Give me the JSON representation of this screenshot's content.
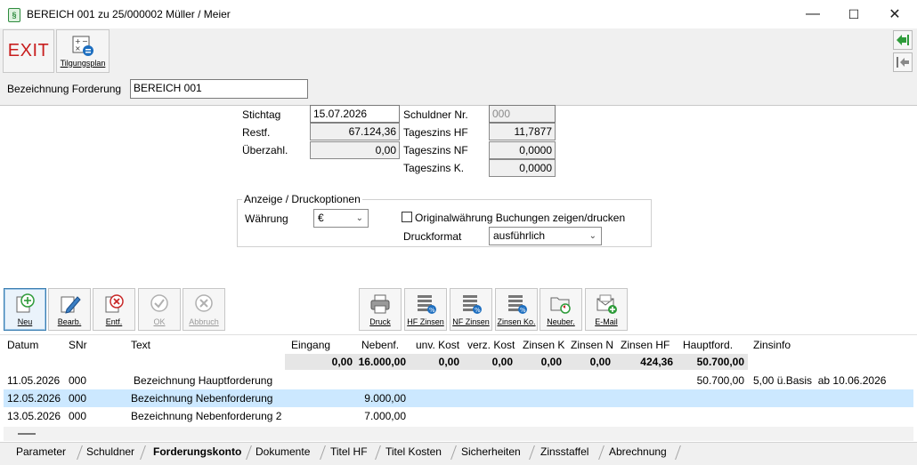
{
  "window": {
    "title": "BEREICH 001 zu 25/000002 Müller / Meier",
    "app_icon": "document-icon",
    "minimize": "—",
    "maximize": "☐",
    "close": "✕"
  },
  "top_toolbar": {
    "exit_label": "EXIT",
    "tilgungsplan_label": "Tilgungsplan"
  },
  "bezeichnung": {
    "label": "Bezeichnung Forderung",
    "value": "BEREICH 001"
  },
  "form": {
    "stichtag_label": "Stichtag",
    "stichtag_value": "15.07.2026",
    "restf_label": "Restf.",
    "restf_value": "67.124,36",
    "ueberzahl_label": "Überzahl.",
    "ueberzahl_value": "0,00",
    "schuldner_label": "Schuldner Nr.",
    "schuldner_value": "000",
    "tageszins_hf_label": "Tageszins HF",
    "tageszins_hf_value": "11,7877",
    "tageszins_nf_label": "Tageszins NF",
    "tageszins_nf_value": "0,0000",
    "tageszins_k_label": "Tageszins K.",
    "tageszins_k_value": "0,0000"
  },
  "options": {
    "group_title": "Anzeige / Druckoptionen",
    "waehrung_label": "Währung",
    "waehrung_value": "€",
    "original_label": "Originalwährung Buchungen zeigen/drucken",
    "original_checked": false,
    "druckformat_label": "Druckformat",
    "druckformat_value": "ausführlich"
  },
  "action_toolbar": {
    "neu": "Neu",
    "bearb": "Bearb.",
    "entf": "Entf.",
    "ok": "OK",
    "abbruch": "Abbruch",
    "druck": "Druck",
    "hf_zinsen": "HF Zinsen",
    "nf_zinsen": "NF Zinsen",
    "zinsen_ko": "Zinsen Ko.",
    "neuber": "Neuber.",
    "email": "E-Mail"
  },
  "grid": {
    "headers": {
      "datum": "Datum",
      "snr": "SNr",
      "text": "Text",
      "eingang": "Eingang",
      "nebenf": "Nebenf.",
      "unv_kost": "unv. Kost",
      "verz_kost": "verz. Kost",
      "zinsen_k": "Zinsen K",
      "zinsen_n": "Zinsen N",
      "zinsen_hf": "Zinsen HF",
      "hauptford": "Hauptford.",
      "zinsinfo": "Zinsinfo"
    },
    "sums": {
      "eingang": "0,00",
      "nebenf": "16.000,00",
      "unv_kost": "0,00",
      "verz_kost": "0,00",
      "zinsen_k": "0,00",
      "zinsen_n": "0,00",
      "zinsen_hf": "424,36",
      "hauptford": "50.700,00"
    },
    "rows": [
      {
        "datum": "11.05.2026",
        "snr": "000",
        "text": "Bezeichnung Hauptforderung",
        "nebenf": "",
        "hauptford": "50.700,00",
        "zinsinfo": "5,00 ü.Basis  ab 10.06.2026"
      },
      {
        "datum": "12.05.2026",
        "snr": "000",
        "text": "Bezeichnung Nebenforderung",
        "nebenf": "9.000,00",
        "hauptford": "",
        "zinsinfo": ""
      },
      {
        "datum": "13.05.2026",
        "snr": "000",
        "text": "Bezeichnung Nebenforderung 2",
        "nebenf": "7.000,00",
        "hauptford": "",
        "zinsinfo": ""
      }
    ]
  },
  "tabs": [
    "Parameter",
    "Schuldner",
    "Forderungskonto",
    "Dokumente",
    "Titel HF",
    "Titel Kosten",
    "Sicherheiten",
    "Zinsstaffel",
    "Abrechnung"
  ],
  "active_tab": "Forderungskonto"
}
